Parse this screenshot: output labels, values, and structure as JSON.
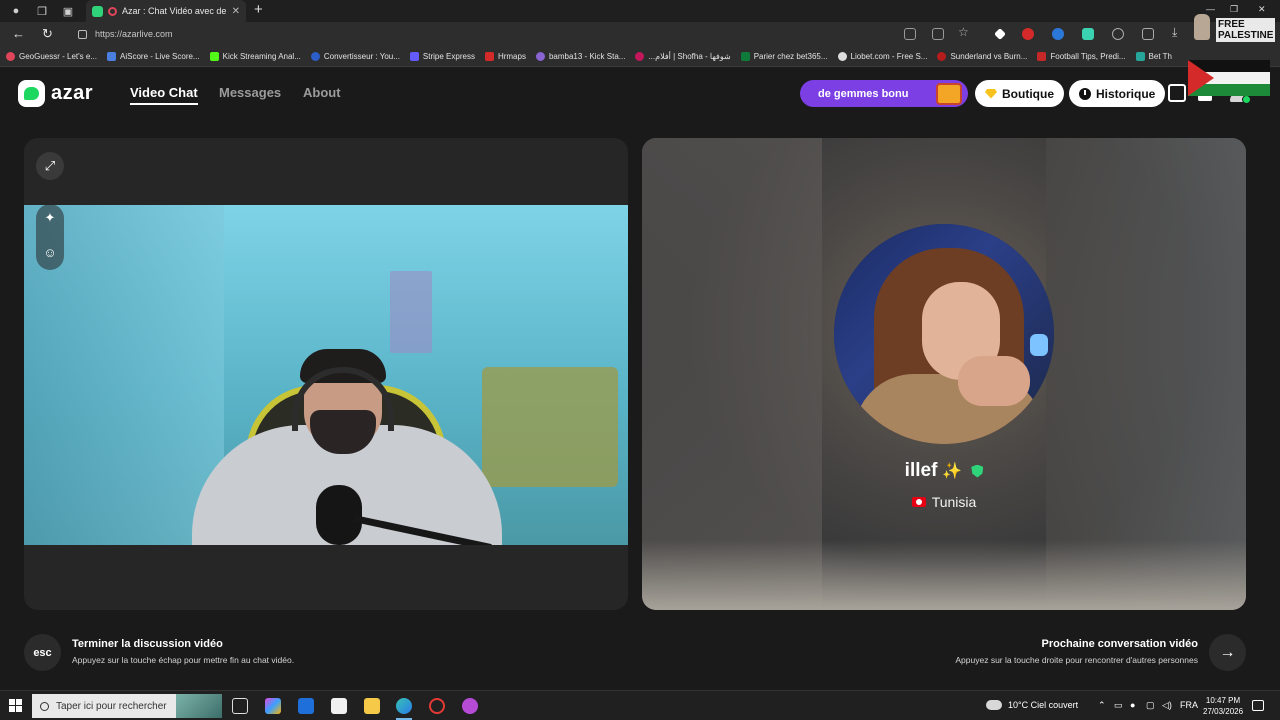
{
  "browser": {
    "tab_title": "Azar : Chat Vidéo avec de n",
    "url": "https://azarlive.com",
    "bookmarks": [
      "GeoGuessr - Let's e...",
      "AiScore - Live Score...",
      "Kick Streaming Anal...",
      "Convertisseur : You...",
      "Stripe Express",
      "Hrmaps",
      "bamba13 - Kick Sta...",
      "...أفلام | Shofha - شوفها",
      "Parier chez bet365...",
      "Liobet.com - Free S...",
      "Sunderland vs Burn...",
      "Football Tips, Predi...",
      "Bet Th"
    ]
  },
  "overlay": {
    "badge_text_1": "FREE",
    "badge_text_2": "PALESTINE"
  },
  "header": {
    "logo_text": "azar",
    "nav": [
      "Video Chat",
      "Messages",
      "About"
    ],
    "promo_text": "de gemmes bonu",
    "boutique_label": "Boutique",
    "historique_label": "Historique"
  },
  "match": {
    "name": "illef",
    "sparkle": "✨",
    "country": "Tunisia"
  },
  "footer": {
    "esc_key": "esc",
    "end_title": "Terminer la discussion vidéo",
    "end_sub": "Appuyez sur la touche échap pour mettre fin au chat vidéo.",
    "next_title": "Prochaine conversation vidéo",
    "next_sub": "Appuyez sur la touche droite pour rencontrer d'autres personnes",
    "next_arrow": "→"
  },
  "taskbar": {
    "search_placeholder": "Taper ici pour rechercher",
    "weather": "10°C  Ciel couvert",
    "lang": "FRA",
    "time": "10:47 PM",
    "date": "27/03/2026"
  },
  "colors": {
    "accent_green": "#1ed760",
    "promo_purple": "#7b3fe4"
  }
}
